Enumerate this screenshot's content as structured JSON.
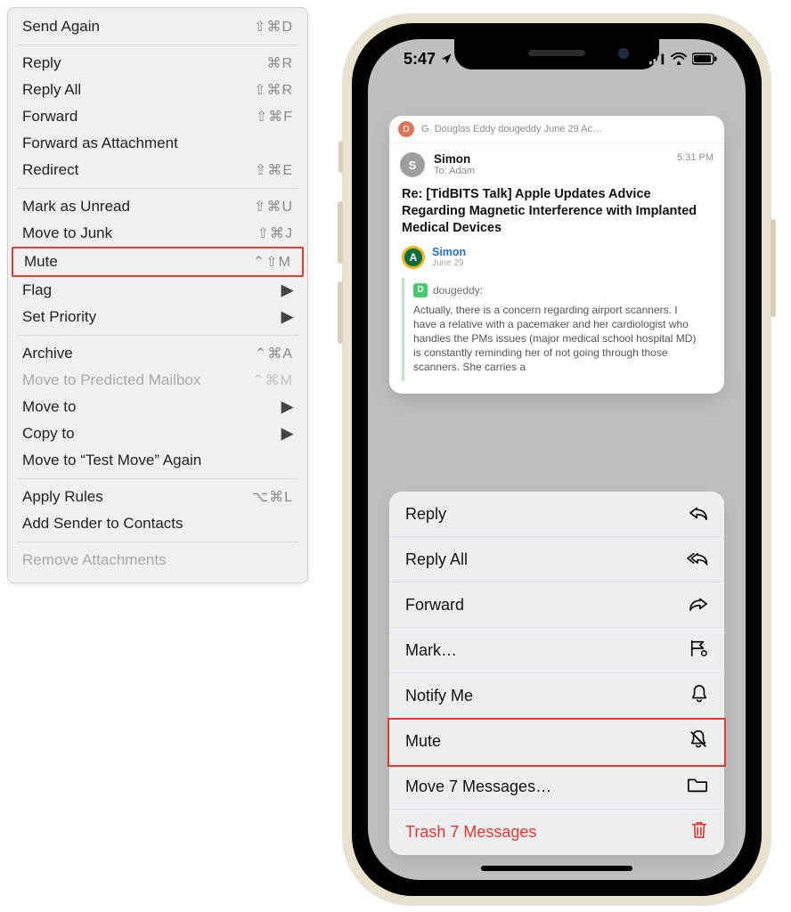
{
  "mac_menu": {
    "groups": [
      [
        {
          "label": "Send Again",
          "shortcut": "⇧⌘D"
        }
      ],
      [
        {
          "label": "Reply",
          "shortcut": "⌘R"
        },
        {
          "label": "Reply All",
          "shortcut": "⇧⌘R"
        },
        {
          "label": "Forward",
          "shortcut": "⇧⌘F"
        },
        {
          "label": "Forward as Attachment",
          "shortcut": ""
        },
        {
          "label": "Redirect",
          "shortcut": "⇧⌘E"
        }
      ],
      [
        {
          "label": "Mark as Unread",
          "shortcut": "⇧⌘U"
        },
        {
          "label": "Move to Junk",
          "shortcut": "⇧⌘J"
        },
        {
          "label": "Mute",
          "shortcut": "⌃⇧M",
          "highlighted": true
        },
        {
          "label": "Flag",
          "submenu": true
        },
        {
          "label": "Set Priority",
          "submenu": true
        }
      ],
      [
        {
          "label": "Archive",
          "shortcut": "⌃⌘A"
        },
        {
          "label": "Move to Predicted Mailbox",
          "shortcut": "⌃⌘M",
          "disabled": true
        },
        {
          "label": "Move to",
          "submenu": true
        },
        {
          "label": "Copy to",
          "submenu": true
        },
        {
          "label": "Move to “Test Move” Again",
          "shortcut": ""
        }
      ],
      [
        {
          "label": "Apply Rules",
          "shortcut": "⌥⌘L"
        },
        {
          "label": "Add Sender to Contacts",
          "shortcut": ""
        }
      ],
      [
        {
          "label": "Remove Attachments",
          "disabled": true
        }
      ]
    ]
  },
  "phone": {
    "status": {
      "time": "5:47",
      "location_arrow": "➤"
    },
    "preview": {
      "prev_thread": {
        "initial": "D",
        "text": "G. Douglas Eddy dougeddy June 29 Ac…"
      },
      "from_initial": "S",
      "from": "Simon",
      "to_label": "To:",
      "to": "Adam",
      "time": "5:31 PM",
      "subject": "Re: [TidBITS Talk] Apple Updates Advice Regarding Magnetic Interference with Implanted Medical Devices",
      "badge_initial": "A",
      "quoted_author": "Simon",
      "quoted_date": "June 29",
      "quoted_from_initial": "D",
      "quoted_from": "dougeddy:",
      "quoted_body": "Actually, there is a concern regarding airport scanners. I have a relative with a pacemaker and her cardiologist who handles the PMs issues (major medical school hospital MD) is constantly reminding her of not going through those scanners. She carries a"
    },
    "sheet": {
      "items": [
        {
          "label": "Reply",
          "icon": "reply"
        },
        {
          "label": "Reply All",
          "icon": "reply-all"
        },
        {
          "label": "Forward",
          "icon": "forward"
        },
        {
          "label": "Mark…",
          "icon": "flag"
        },
        {
          "label": "Notify Me",
          "icon": "bell"
        },
        {
          "label": "Mute",
          "icon": "bell-slash",
          "highlighted": true
        },
        {
          "label": "Move 7 Messages…",
          "icon": "folder"
        },
        {
          "label": "Trash 7 Messages",
          "icon": "trash",
          "destructive": true
        }
      ]
    }
  }
}
